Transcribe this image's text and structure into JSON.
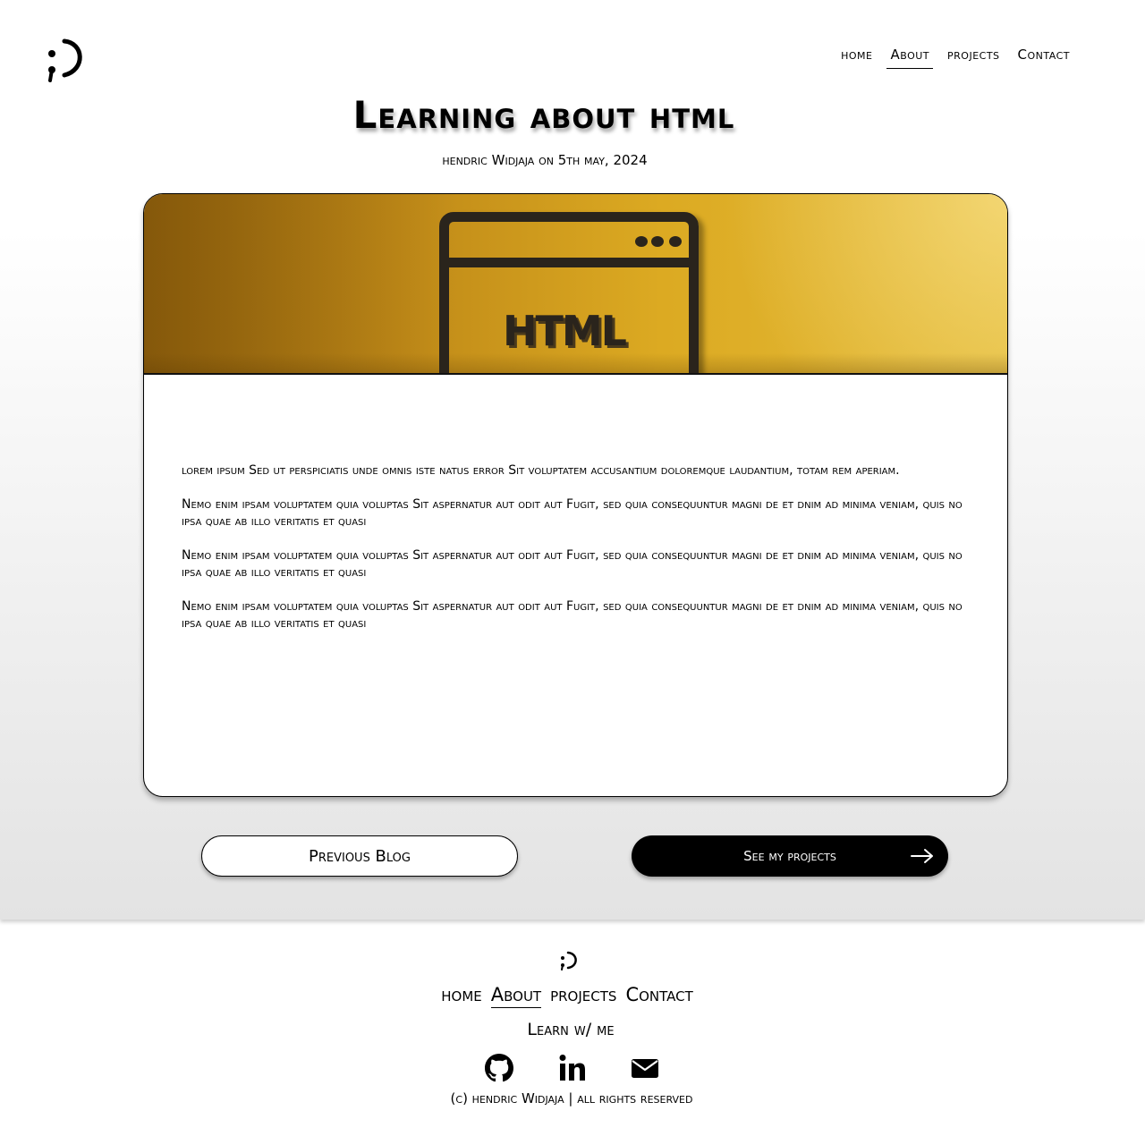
{
  "nav": {
    "items": [
      "home",
      "About",
      "projects",
      "Contact"
    ],
    "active": "About"
  },
  "post": {
    "title": "Learning about html",
    "byline": "hendric Widjaja on 5th may, 2024",
    "hero_text": "HTML",
    "paragraphs": [
      "lorem ipsum Sed ut perspiciatis unde omnis iste natus error Sit voluptatem accusantium doloremque laudantium, totam rem aperiam.",
      "Nemo enim ipsam voluptatem quia voluptas Sit aspernatur aut odit aut Fugit, sed quia consequuntur magni de et dnim ad minima veniam, quis no ipsa quae ab illo  veritatis et quasi",
      "Nemo enim ipsam voluptatem quia voluptas Sit aspernatur aut odit aut Fugit, sed quia consequuntur magni de et dnim ad minima veniam, quis no ipsa quae ab illo  veritatis et quasi",
      "Nemo enim ipsam voluptatem quia voluptas Sit aspernatur aut odit aut Fugit, sed quia consequuntur magni de et dnim ad minima veniam, quis no ipsa quae ab illo  veritatis et quasi"
    ]
  },
  "buttons": {
    "previous": "Previous Blog",
    "next": "See my projects"
  },
  "footer": {
    "nav": [
      "home",
      "About",
      "projects",
      "Contact"
    ],
    "tagline": "Learn w/ me",
    "copyright": "(c) hendric Widjaja | all rights reserved",
    "icons": [
      "github-icon",
      "linkedin-icon",
      "envelope-icon"
    ]
  }
}
